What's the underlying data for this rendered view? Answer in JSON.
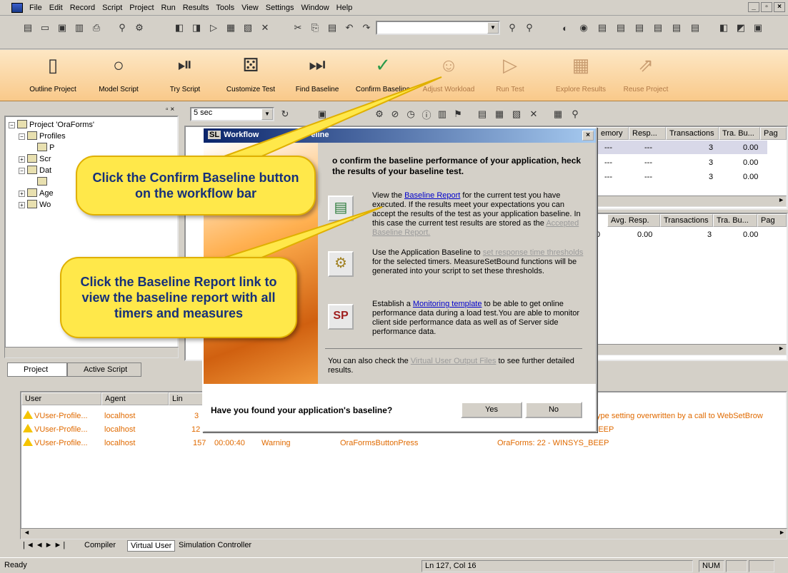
{
  "menu": [
    "File",
    "Edit",
    "Record",
    "Script",
    "Project",
    "Run",
    "Results",
    "Tools",
    "View",
    "Settings",
    "Window",
    "Help"
  ],
  "workflow": [
    {
      "label": "Outline Project",
      "icon": "document-icon",
      "dim": false
    },
    {
      "label": "Model Script",
      "icon": "circle-icon",
      "dim": false
    },
    {
      "label": "Try Script",
      "icon": "play-pause-icon",
      "dim": false
    },
    {
      "label": "Customize Test",
      "icon": "dice-icon",
      "dim": false
    },
    {
      "label": "Find Baseline",
      "icon": "flag-icon",
      "dim": false
    },
    {
      "label": "Confirm Baseline",
      "icon": "checkmark-chart-icon",
      "dim": false
    },
    {
      "label": "Adjust Workload",
      "icon": "users-icon",
      "dim": true
    },
    {
      "label": "Run Test",
      "icon": "play-icon",
      "dim": true
    },
    {
      "label": "Explore Results",
      "icon": "chart-explore-icon",
      "dim": true
    },
    {
      "label": "Reuse Project",
      "icon": "export-icon",
      "dim": true
    }
  ],
  "toolbar": {
    "interval_value": "5 sec"
  },
  "tree": {
    "root": "Project 'OraForms'",
    "profiles": "Profiles",
    "items": [
      "Scr",
      "Dat",
      "Age",
      "Wo"
    ],
    "profile_child": "P"
  },
  "left_tabs": {
    "project": "Project",
    "active_script": "Active Script"
  },
  "grid_top": {
    "headers": [
      "emory",
      "Resp...",
      "Transactions",
      "Tra. Bu...",
      "Pag"
    ],
    "rows": [
      [
        "---",
        "---",
        "3",
        "0.00"
      ],
      [
        "---",
        "---",
        "3",
        "0.00"
      ],
      [
        "---",
        "---",
        "3",
        "0.00"
      ]
    ]
  },
  "grid_mid": {
    "headers": [
      "Avg. Resp.",
      "Transactions",
      "Tra. Bu...",
      "Pag"
    ],
    "row": [
      "0",
      "0.00",
      "3",
      "0.00"
    ]
  },
  "dialog": {
    "title_left": "Workflow",
    "title_right": "eline",
    "title_partial": "SL",
    "headline": "o confirm the baseline performance of your application, heck the results of your baseline test.",
    "sec1_pre": "View the ",
    "sec1_link": "Baseline Report",
    "sec1_post": " for the current test you have executed. If the results meet your expectations you can accept the results of the test as your application baseline. In this case the current test results are stored as the ",
    "sec1_link2": "Accepted Baseline Report.",
    "sec2_pre": "Use the Application Baseline to ",
    "sec2_link": "set response time thresholds",
    "sec2_post": " for the selected timers. MeasureSetBound functions will be generated into your script to set these thresholds.",
    "sec3_pre": "Establish a ",
    "sec3_link": "Monitoring template",
    "sec3_post": " to be able to get online performance data during a load test.You are able to monitor client side performance data as well as of Server side performance data.",
    "sec4_pre": "You can also check the ",
    "sec4_link": "Virtual User Output Files",
    "sec4_post": " to see further detailed results.",
    "question": "Have you found your application's baseline?",
    "yes": "Yes",
    "no": "No"
  },
  "output": {
    "headers": [
      "User",
      "Agent",
      "Lin"
    ],
    "rows": [
      {
        "user": "VUser-Profile...",
        "agent": "localhost",
        "line": "3",
        "time": "",
        "type": "",
        "func": "",
        "msg": " type setting overwritten by a call to WebSetBrow"
      },
      {
        "user": "VUser-Profile...",
        "agent": "localhost",
        "line": "12",
        "time": "",
        "type": "",
        "func": "",
        "msg": "BEEP"
      },
      {
        "user": "VUser-Profile...",
        "agent": "localhost",
        "line": "157",
        "time": "00:00:40",
        "type": "Warning",
        "func": "OraFormsButtonPress",
        "msg": "OraForms: 22 - WINSYS_BEEP"
      }
    ],
    "tabs": [
      "Compiler",
      "Virtual User",
      "Simulation Controller"
    ]
  },
  "callouts": {
    "confirm": "Click the Confirm Baseline button on the workflow bar",
    "report": "Click the Baseline Report link to view the baseline report with all timers and measures"
  },
  "status": {
    "ready": "Ready",
    "position": "Ln 127, Col 16",
    "num": "NUM"
  },
  "colors": {
    "callout": "#ffe84a",
    "callout_text": "#16307a",
    "warning_text": "#e06a00",
    "link": "#0000cc"
  }
}
